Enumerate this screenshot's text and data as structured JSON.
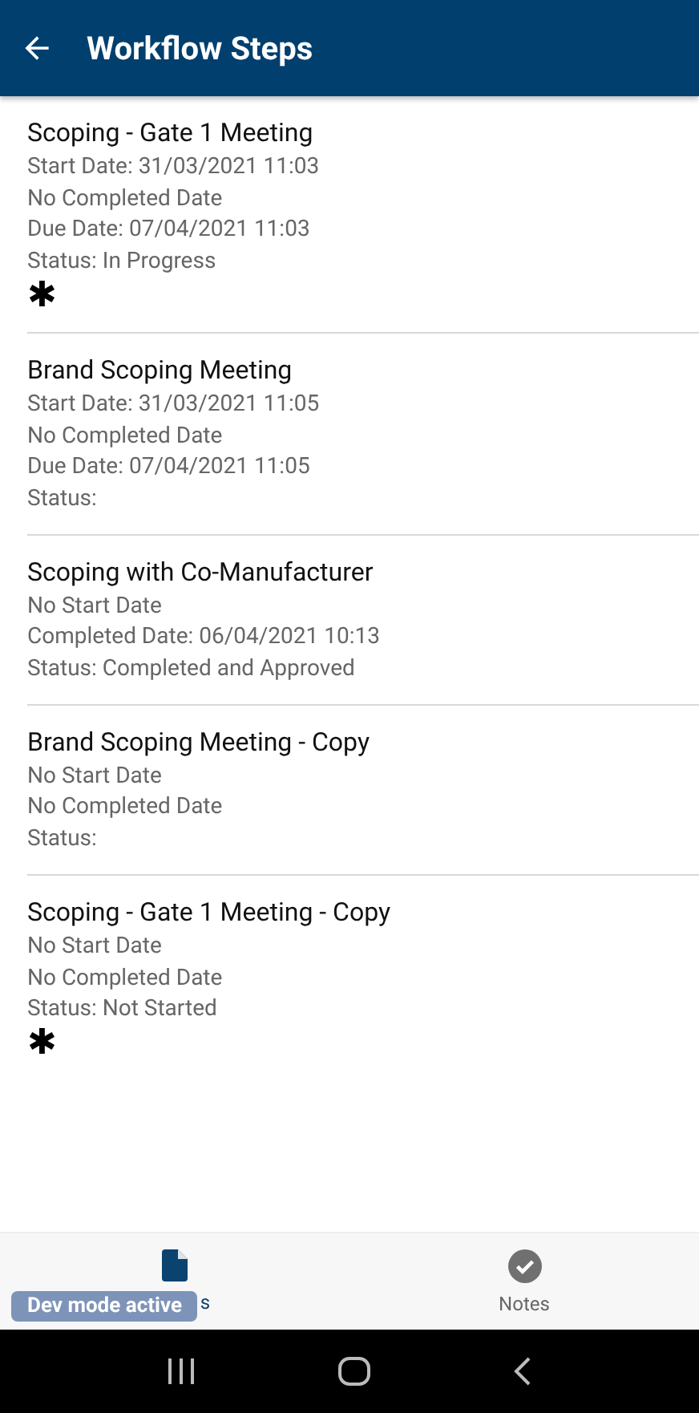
{
  "header": {
    "title": "Workflow Steps"
  },
  "steps": [
    {
      "title": "Scoping - Gate 1 Meeting",
      "lines": [
        "Start Date: 31/03/2021 11:03",
        "No Completed Date",
        "Due Date: 07/04/2021 11:03",
        "Status: In Progress"
      ],
      "marker": "✱"
    },
    {
      "title": "Brand Scoping Meeting",
      "lines": [
        "Start Date: 31/03/2021 11:05",
        "No Completed Date",
        "Due Date: 07/04/2021 11:05",
        "Status:"
      ]
    },
    {
      "title": "Scoping with Co-Manufacturer",
      "lines": [
        "No Start Date",
        "Completed Date: 06/04/2021 10:13",
        "Status: Completed and Approved"
      ]
    },
    {
      "title": "Brand Scoping Meeting - Copy",
      "lines": [
        "No Start Date",
        "No Completed Date",
        "Status:"
      ]
    },
    {
      "title": "Scoping - Gate 1 Meeting - Copy",
      "lines": [
        "No Start Date",
        "No Completed Date",
        "Status: Not Started"
      ],
      "marker": "✱"
    }
  ],
  "tabs": [
    {
      "label": "s",
      "kind": "document",
      "selected": true
    },
    {
      "label": "Notes",
      "kind": "check",
      "selected": false
    }
  ],
  "badge": "Dev mode active"
}
